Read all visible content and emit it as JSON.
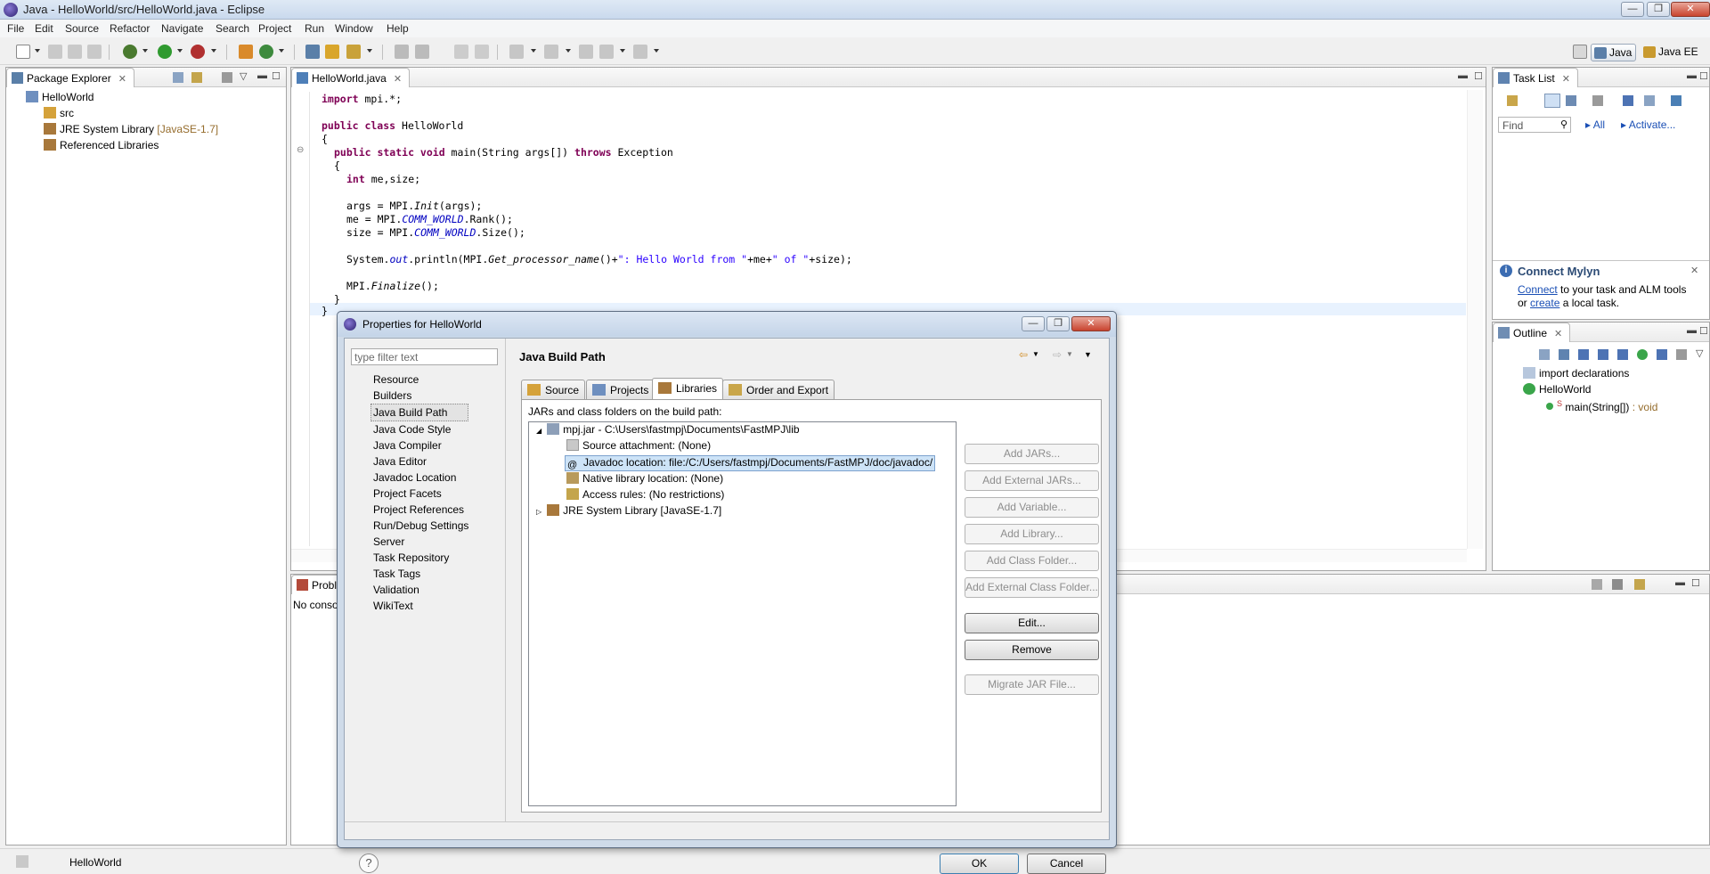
{
  "window": {
    "title": "Java - HelloWorld/src/HelloWorld.java - Eclipse",
    "controls": {
      "minimize": "—",
      "maximize": "❐",
      "close": "✕"
    }
  },
  "menu": [
    "File",
    "Edit",
    "Source",
    "Refactor",
    "Navigate",
    "Search",
    "Project",
    "Run",
    "Window",
    "Help"
  ],
  "perspectives": {
    "java": "Java",
    "java_ee": "Java EE"
  },
  "package_explorer": {
    "tab_label": "Package Explorer",
    "project": "HelloWorld",
    "items": {
      "src": "src",
      "jre": "JRE System Library",
      "jre_version": "[JavaSE-1.7]",
      "ref_libs": "Referenced Libraries"
    }
  },
  "editor": {
    "tab_label": "HelloWorld.java",
    "lines": {
      "l1_kw": "import",
      "l1_rest": " mpi.*;",
      "l3_kw": "public class",
      "l3_rest": " HelloWorld",
      "l4": "{",
      "l5_kw": "public static void",
      "l5_mid": " main(String args[]) ",
      "l5_kw2": "throws",
      "l5_end": " Exception",
      "l6": "{",
      "l7_kw": "int",
      "l7_rest": " me,size;",
      "l9_a": "args = MPI.",
      "l9_b": "Init",
      "l9_c": "(args);",
      "l10_a": "me = MPI.",
      "l10_b": "COMM_WORLD",
      "l10_c": ".Rank();",
      "l11_a": "size = MPI.",
      "l11_b": "COMM_WORLD",
      "l11_c": ".Size();",
      "l13_a": "System.",
      "l13_b": "out",
      "l13_c": ".println(MPI.",
      "l13_d": "Get_processor_name",
      "l13_e": "()+",
      "l13_f": "\": Hello World from \"",
      "l13_g": "+me+",
      "l13_h": "\" of \"",
      "l13_i": "+size);",
      "l15_a": "MPI.",
      "l15_b": "Finalize",
      "l15_c": "();",
      "l16": "}",
      "l17": "}"
    }
  },
  "problems": {
    "tab_label": "Probl",
    "text": "No conso"
  },
  "task_list": {
    "tab_label": "Task List",
    "find_placeholder": "Find",
    "all": "All",
    "activate": "Activate..."
  },
  "mylyn": {
    "title": "Connect Mylyn",
    "connect": "Connect",
    "text1": " to your task and ALM tools",
    "or": "or ",
    "create": "create",
    "text2": " a local task."
  },
  "outline": {
    "tab_label": "Outline",
    "items": {
      "imports": "import declarations",
      "class": "HelloWorld",
      "method": "main(String[])",
      "method_type": " : void",
      "method_mark": "S"
    }
  },
  "status_bar": {
    "text": "HelloWorld"
  },
  "dialog": {
    "title": "Properties for HelloWorld",
    "filter_placeholder": "type filter text",
    "nav": [
      "Resource",
      "Builders",
      "Java Build Path",
      "Java Code Style",
      "Java Compiler",
      "Java Editor",
      "Javadoc Location",
      "Project Facets",
      "Project References",
      "Run/Debug Settings",
      "Server",
      "Task Repository",
      "Task Tags",
      "Validation",
      "WikiText"
    ],
    "page_title": "Java Build Path",
    "tabs": [
      "Source",
      "Projects",
      "Libraries",
      "Order and Export"
    ],
    "libraries_label": "JARs and class folders on the build path:",
    "tree": {
      "jar": "mpj.jar - C:\\Users\\fastmpj\\Documents\\FastMPJ\\lib",
      "source": "Source attachment: (None)",
      "javadoc": "Javadoc location: file:/C:/Users/fastmpj/Documents/FastMPJ/doc/javadoc/",
      "native": "Native library location: (None)",
      "access": "Access rules: (No restrictions)",
      "jre": "JRE System Library [JavaSE-1.7]"
    },
    "buttons": {
      "add_jars": "Add JARs...",
      "add_external_jars": "Add External JARs...",
      "add_variable": "Add Variable...",
      "add_library": "Add Library...",
      "add_class_folder": "Add Class Folder...",
      "add_external_class_folder": "Add External Class Folder...",
      "edit": "Edit...",
      "remove": "Remove",
      "migrate": "Migrate JAR File..."
    },
    "ok": "OK",
    "cancel": "Cancel",
    "help": "?"
  },
  "colors": {
    "keyword": "#7f0055",
    "field": "#0000c0",
    "string": "#2a00ff",
    "link": "#1a4fb5",
    "selection": "#cde3f7"
  }
}
